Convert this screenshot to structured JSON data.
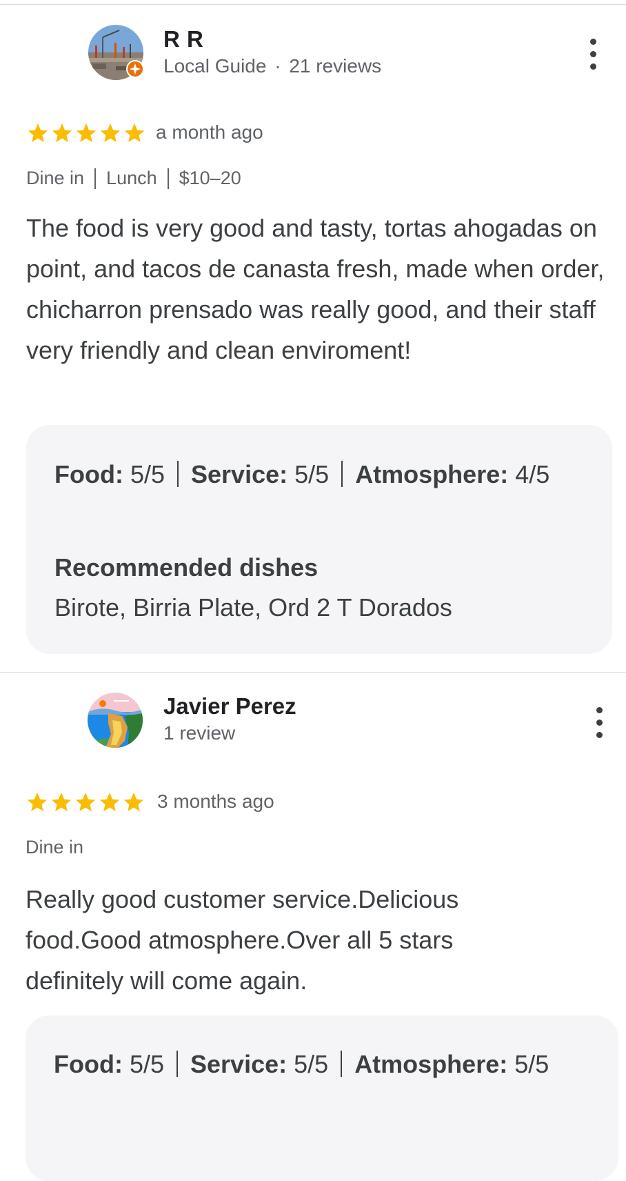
{
  "reviews": [
    {
      "author": "R R",
      "badge": "Local Guide",
      "review_count": "21 reviews",
      "rating_stars": 5,
      "time_ago": "a month ago",
      "tags": [
        "Dine in",
        "Lunch",
        "$10–20"
      ],
      "text": "The food is very good and tasty, tortas ahogadas on point, and tacos de canasta fresh, made when order, chicharron prensado was really good, and their staff very friendly and clean enviroment!",
      "ratings": {
        "food_label": "Food:",
        "food_value": "5/5",
        "service_label": "Service:",
        "service_value": "5/5",
        "atmosphere_label": "Atmosphere:",
        "atmosphere_value": "4/5"
      },
      "recommended_title": "Recommended dishes",
      "recommended_dishes": "Birote, Birria Plate, Ord 2 T Dorados"
    },
    {
      "author": "Javier Perez",
      "review_count": "1 review",
      "rating_stars": 5,
      "time_ago": "3 months ago",
      "tags": [
        "Dine in"
      ],
      "text": "Really good customer service.Delicious food.Good atmosphere.Over all 5 stars definitely will come again.",
      "ratings": {
        "food_label": "Food:",
        "food_value": "5/5",
        "service_label": "Service:",
        "service_value": "5/5",
        "atmosphere_label": "Atmosphere:",
        "atmosphere_value": "5/5"
      }
    }
  ],
  "separator_dot": "·",
  "colors": {
    "star": "#fbbc04",
    "guide_badge": "#e8710a",
    "card_bg": "#f5f5f7",
    "muted_text": "#5f6368"
  },
  "icons": {
    "more": "more-vert-icon",
    "star": "star-icon",
    "badge": "local-guide-badge-icon"
  }
}
